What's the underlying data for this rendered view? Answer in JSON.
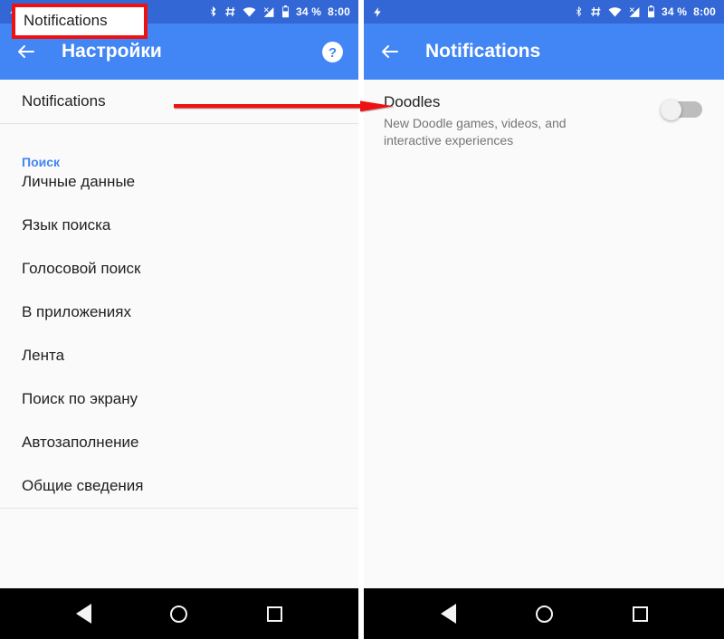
{
  "status_bar": {
    "left_icons": [
      "lightning-bolt-icon"
    ],
    "right_icons": [
      "bluetooth-icon",
      "hash-icon",
      "wifi-icon",
      "signal-icon",
      "battery-icon"
    ],
    "battery_percent": "34 %",
    "time": "8:00"
  },
  "left_panel": {
    "app_bar": {
      "back_icon": "back-arrow-icon",
      "title": "Настройки",
      "help_icon": "help-question-icon"
    },
    "highlighted_row": {
      "label": "Notifications"
    },
    "section_header": "Поиск",
    "items": [
      {
        "label": "Личные данные"
      },
      {
        "label": "Язык поиска"
      },
      {
        "label": "Голосовой поиск"
      },
      {
        "label": "В приложениях"
      },
      {
        "label": "Лента"
      },
      {
        "label": "Поиск по экрану"
      },
      {
        "label": "Автозаполнение"
      },
      {
        "label": "Общие сведения"
      }
    ]
  },
  "right_panel": {
    "app_bar": {
      "back_icon": "back-arrow-icon",
      "title": "Notifications"
    },
    "preference": {
      "title": "Doodles",
      "summary": "New Doodle games, videos, and interactive experiences",
      "toggle_state": "off"
    }
  },
  "nav_bar": {
    "back": "nav-back-triangle-icon",
    "home": "nav-home-circle-icon",
    "recents": "nav-recents-square-icon"
  },
  "annotation": {
    "type": "arrow",
    "color": "#ee1111",
    "highlight_box_color": "#ee1111"
  }
}
